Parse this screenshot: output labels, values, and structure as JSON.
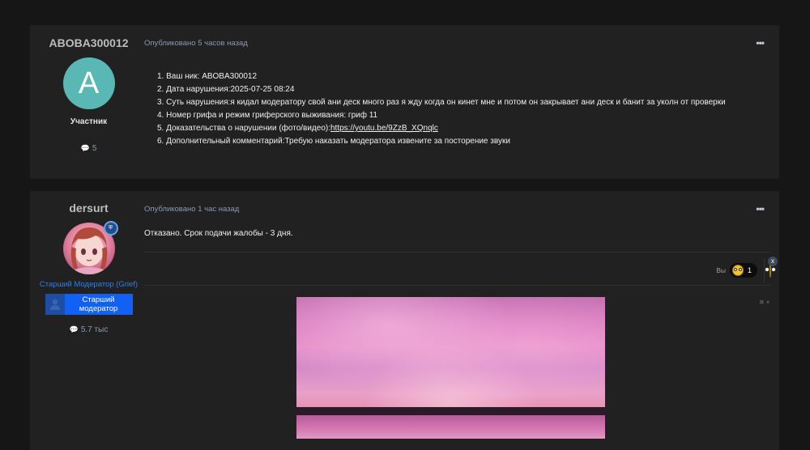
{
  "post1": {
    "author": "ABOBA300012",
    "avatar_letter": "A",
    "rank": "Участник",
    "post_count": "5",
    "meta": "Опубликовано 5 часов назад",
    "lines": [
      "1. Ваш ник: ABOBA300012",
      "2. Дата нарушения:2025-07-25 08:24",
      "3. Суть нарушения:я кидал модератору свой ани деск много раз я жду когда он кинет мне и потом он закрывает ани деск и банит за уколн от проверки",
      "4. Номер грифа и режим гриферского выживания: гриф 11"
    ],
    "proof_label": "5. Доказательства о нарушении (фото/видео):",
    "proof_link": "https://youtu.be/9ZzB_XQnqlc",
    "comment_line": "6. Дополнительный комментарий:Требую наказать модератора извените за посторение звуки"
  },
  "post2": {
    "author": "dersurt",
    "role_link": "Старший Модератор (Grief)",
    "group_badge": "Старший модератор",
    "post_count": "5.7 тыс",
    "meta": "Опубликовано 1 час назад",
    "content": "Отказано. Срок подачи жалобы - 3 дня.",
    "reaction_you": "Вы",
    "reaction_count": "1"
  },
  "icons": {
    "more": "•••",
    "comment": "💬",
    "close_x": "x",
    "shield": "⛨",
    "user": "👤"
  }
}
